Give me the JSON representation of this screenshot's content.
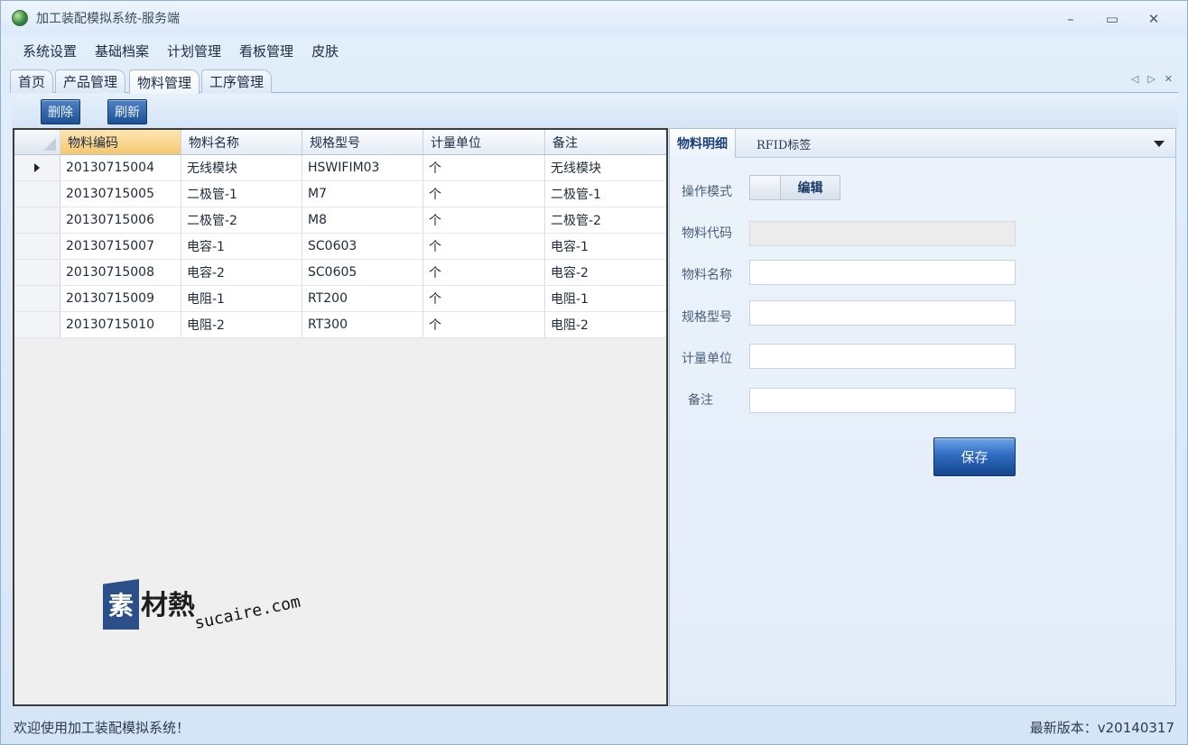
{
  "window": {
    "title": "加工装配模拟系统-服务端",
    "controls": {
      "minimize": "–",
      "maximize": "▭",
      "close": "✕"
    }
  },
  "menu": [
    "系统设置",
    "基础档案",
    "计划管理",
    "看板管理",
    "皮肤"
  ],
  "tabs": [
    {
      "label": "首页",
      "active": false
    },
    {
      "label": "产品管理",
      "active": false
    },
    {
      "label": "物料管理",
      "active": true
    },
    {
      "label": "工序管理",
      "active": false
    }
  ],
  "tab_strip_icons": {
    "prev": "◁",
    "next": "▷",
    "close": "✕"
  },
  "toolbar": {
    "delete_label": "删除",
    "refresh_label": "刷新"
  },
  "grid": {
    "columns": [
      "物料编码",
      "物料名称",
      "规格型号",
      "计量单位",
      "备注"
    ],
    "sorted_column": 0,
    "selected_row": 0,
    "rows": [
      [
        "20130715004",
        "无线模块",
        "HSWIFIM03",
        "个",
        "无线模块"
      ],
      [
        "20130715005",
        "二极管-1",
        "M7",
        "个",
        "二极管-1"
      ],
      [
        "20130715006",
        "二极管-2",
        "M8",
        "个",
        "二极管-2"
      ],
      [
        "20130715007",
        "电容-1",
        "SC0603",
        "个",
        "电容-1"
      ],
      [
        "20130715008",
        "电容-2",
        "SC0605",
        "个",
        "电容-2"
      ],
      [
        "20130715009",
        "电阻-1",
        "RT200",
        "个",
        "电阻-1"
      ],
      [
        "20130715010",
        "电阻-2",
        "RT300",
        "个",
        "电阻-2"
      ]
    ]
  },
  "watermark": {
    "box_char": "素",
    "chars": "材熱",
    "url": "sucaire.com"
  },
  "detail": {
    "tabs": [
      "物料明细",
      "RFID标签"
    ],
    "mode_label": "操作模式",
    "mode_value": "编辑",
    "fields": [
      {
        "label": "物料代码",
        "value": "",
        "disabled": true
      },
      {
        "label": "物料名称",
        "value": "",
        "disabled": false
      },
      {
        "label": "规格型号",
        "value": "",
        "disabled": false
      },
      {
        "label": "计量单位",
        "value": "",
        "disabled": false
      },
      {
        "label": "备注",
        "value": "",
        "disabled": false
      }
    ],
    "save_label": "保存"
  },
  "status": {
    "welcome": "欢迎使用加工装配模拟系统！",
    "version": "最新版本：v20140317"
  }
}
